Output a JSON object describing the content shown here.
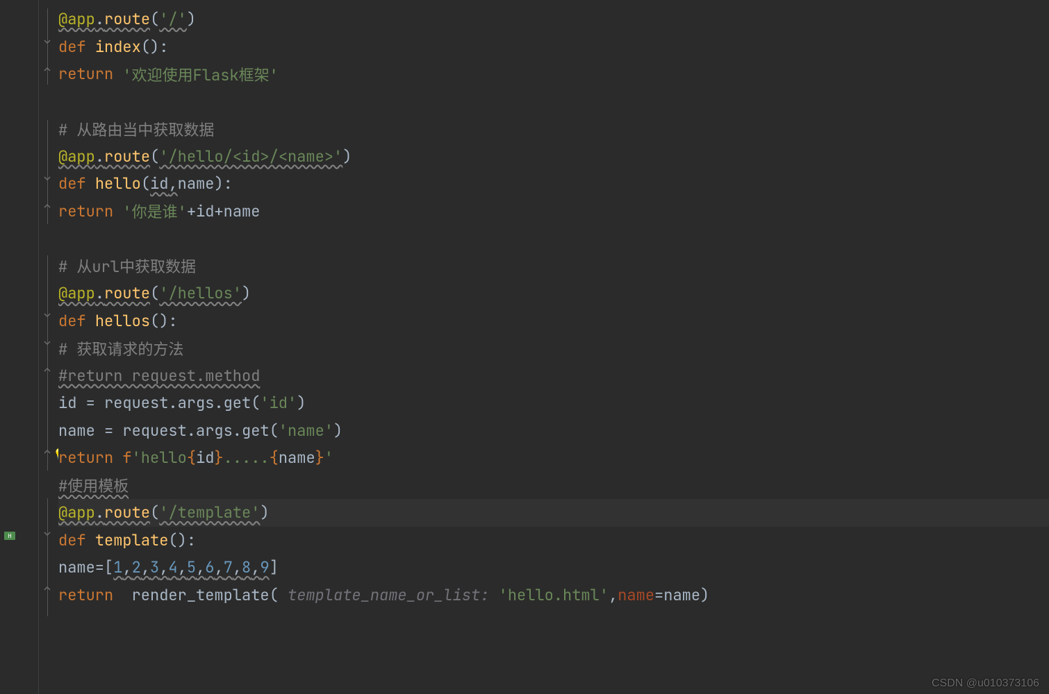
{
  "code": {
    "l1": {
      "dec": "@app",
      "dot": ".",
      "route": "route",
      "p1": "(",
      "s": "'/'",
      "p2": ")"
    },
    "l2": {
      "def": "def ",
      "fn": "index",
      "sig": "():"
    },
    "l3": {
      "ret": "return ",
      "s": "'欢迎使用Flask框架'"
    },
    "l5": {
      "cmt": "# 从路由当中获取数据"
    },
    "l6": {
      "dec": "@app",
      "dot": ".",
      "route": "route",
      "p1": "(",
      "s": "'/hello/<id>/<name>'",
      "p2": ")"
    },
    "l7": {
      "def": "def ",
      "fn": "hello",
      "open": "(",
      "a1": "id",
      "comma": ",",
      "a2": "name",
      "close": "):"
    },
    "l8": {
      "ret": "return ",
      "s": "'你是谁'",
      "plus1": "+id+name"
    },
    "l10": {
      "cmt": "# 从url中获取数据"
    },
    "l11": {
      "dec": "@app",
      "dot": ".",
      "route": "route",
      "p1": "(",
      "s": "'/hellos'",
      "p2": ")"
    },
    "l12": {
      "def": "def ",
      "fn": "hellos",
      "sig": "():"
    },
    "l13": {
      "cmt": "# 获取请求的方法"
    },
    "l14": {
      "cmt": "#return request.method"
    },
    "l15": {
      "lhs": "id = request.args.get(",
      "s": "'id'",
      "rhs": ")"
    },
    "l16": {
      "lhs": "name = request.args.get(",
      "s": "'name'",
      "rhs": ")"
    },
    "l17": {
      "ret": "return ",
      "f": "f",
      "s1": "'hello",
      "b1": "{",
      "v1": "id",
      "b2": "}",
      "mid": ".....",
      "b3": "{",
      "v2": "name",
      "b4": "}",
      "s2": "'"
    },
    "l18": {
      "cmt": "#使用模板"
    },
    "l19": {
      "dec": "@app",
      "dot": ".",
      "route": "route",
      "p1": "(",
      "s": "'/template'",
      "p2": ")"
    },
    "l20": {
      "def": "def ",
      "fn": "template",
      "sig": "():"
    },
    "l21": {
      "lhs": "name=[",
      "n1": "1",
      "c": ",",
      "n2": "2",
      "n3": "3",
      "n4": "4",
      "n5": "5",
      "n6": "6",
      "n7": "7",
      "n8": "8",
      "n9": "9",
      "rhs": "]"
    },
    "l22": {
      "ret": "return  ",
      "call": "render_template(",
      "hint": " template_name_or_list: ",
      "s": "'hello.html'",
      "comma": ",",
      "kw": "name",
      "eq": "=name)"
    }
  },
  "watermark": "CSDN @u010373106"
}
